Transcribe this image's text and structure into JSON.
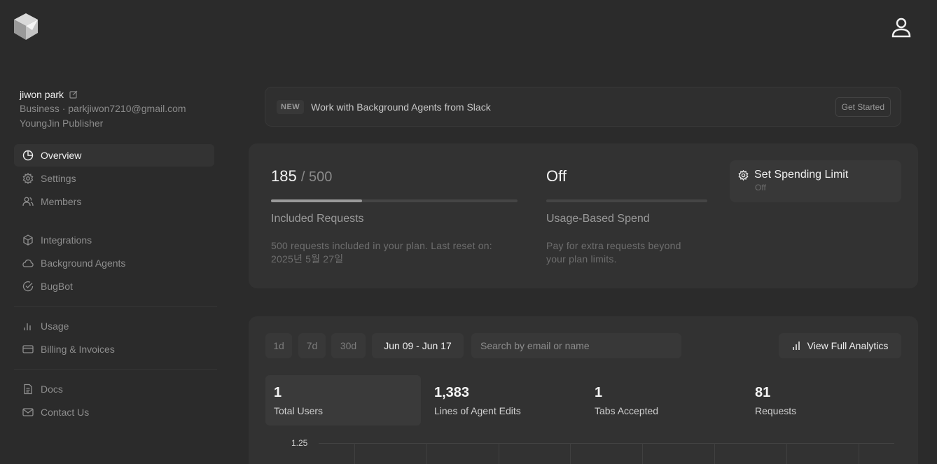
{
  "profile": {
    "name": "jiwon park",
    "plan_email": "Business · parkjiwon7210@gmail.com",
    "org": "YoungJin Publisher"
  },
  "nav": {
    "overview": "Overview",
    "settings": "Settings",
    "members": "Members",
    "integrations": "Integrations",
    "background_agents": "Background Agents",
    "bugbot": "BugBot",
    "usage": "Usage",
    "billing": "Billing & Invoices",
    "docs": "Docs",
    "contact": "Contact Us"
  },
  "banner": {
    "badge": "NEW",
    "text": "Work with Background Agents from Slack",
    "button": "Get Started"
  },
  "usage": {
    "requests_used": "185",
    "requests_limit": "/ 500",
    "requests_fraction": 0.37,
    "requests_title": "Included Requests",
    "requests_desc_1": "500 requests included in your plan. Last reset on:",
    "requests_desc_2": "2025년 5월 27일",
    "spend_status": "Off",
    "spend_fraction": 0,
    "spend_title": "Usage-Based Spend",
    "spend_desc_1": "Pay for extra requests beyond",
    "spend_desc_2": "your plan limits.",
    "limit_button": "Set Spending Limit",
    "limit_sub": "Off"
  },
  "analytics": {
    "ranges": [
      "1d",
      "7d",
      "30d",
      "Jun 09 - Jun 17"
    ],
    "search_placeholder": "Search by email or name",
    "view_button": "View Full Analytics",
    "stats": [
      {
        "value": "1",
        "label": "Total Users"
      },
      {
        "value": "1,383",
        "label": "Lines of Agent Edits"
      },
      {
        "value": "1",
        "label": "Tabs Accepted"
      },
      {
        "value": "81",
        "label": "Requests"
      }
    ],
    "chart_y_top": "1.25"
  }
}
